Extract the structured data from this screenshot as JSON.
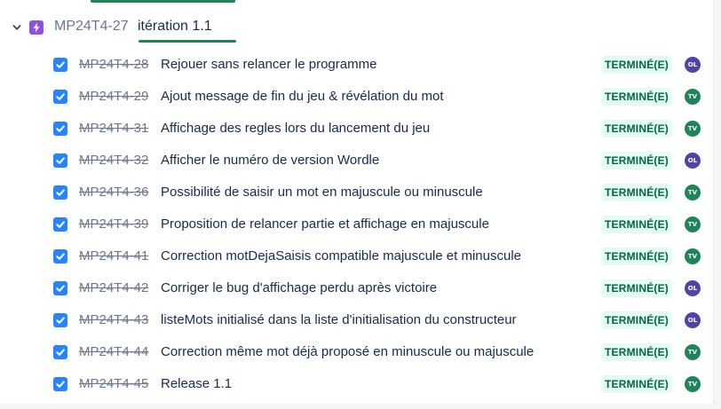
{
  "epic": {
    "key": "MP24T4-27",
    "title": "itération 1.1",
    "icon": "epic-lightning-icon",
    "icon_color": "#904ee2",
    "expanded": true
  },
  "colors": {
    "done_bg": "#e3fcef",
    "done_text": "#006644",
    "checkbox": "#2684ff",
    "avatar_ol": "#5243aa",
    "avatar_tv": "#1f845a",
    "progress": "#1f845a"
  },
  "issues": [
    {
      "key": "MP24T4-28",
      "summary": "Rejouer sans relancer le programme",
      "status": "TERMINÉ(E)",
      "assignee": "OL",
      "checked": true
    },
    {
      "key": "MP24T4-29",
      "summary": "Ajout message de fin du jeu & révélation du mot",
      "status": "TERMINÉ(E)",
      "assignee": "TV",
      "checked": true
    },
    {
      "key": "MP24T4-31",
      "summary": "Affichage des regles lors du lancement du jeu",
      "status": "TERMINÉ(E)",
      "assignee": "TV",
      "checked": true
    },
    {
      "key": "MP24T4-32",
      "summary": "Afficher le numéro de version Wordle",
      "status": "TERMINÉ(E)",
      "assignee": "OL",
      "checked": true
    },
    {
      "key": "MP24T4-36",
      "summary": "Possibilité de saisir un mot en majuscule ou minuscule",
      "status": "TERMINÉ(E)",
      "assignee": "TV",
      "checked": true
    },
    {
      "key": "MP24T4-39",
      "summary": "Proposition de relancer partie et affichage en majuscule",
      "status": "TERMINÉ(E)",
      "assignee": "TV",
      "checked": true
    },
    {
      "key": "MP24T4-41",
      "summary": "Correction motDejaSaisis compatible majuscule et minuscule",
      "status": "TERMINÉ(E)",
      "assignee": "TV",
      "checked": true
    },
    {
      "key": "MP24T4-42",
      "summary": "Corriger le bug d'affichage perdu après victoire",
      "status": "TERMINÉ(E)",
      "assignee": "OL",
      "checked": true
    },
    {
      "key": "MP24T4-43",
      "summary": "listeMots initialisé dans la liste d'initialisation du constructeur",
      "status": "TERMINÉ(E)",
      "assignee": "OL",
      "checked": true
    },
    {
      "key": "MP24T4-44",
      "summary": "Correction même mot déjà proposé en minuscule ou majuscule",
      "status": "TERMINÉ(E)",
      "assignee": "TV",
      "checked": true
    },
    {
      "key": "MP24T4-45",
      "summary": "Release 1.1",
      "status": "TERMINÉ(E)",
      "assignee": "TV",
      "checked": true
    }
  ]
}
